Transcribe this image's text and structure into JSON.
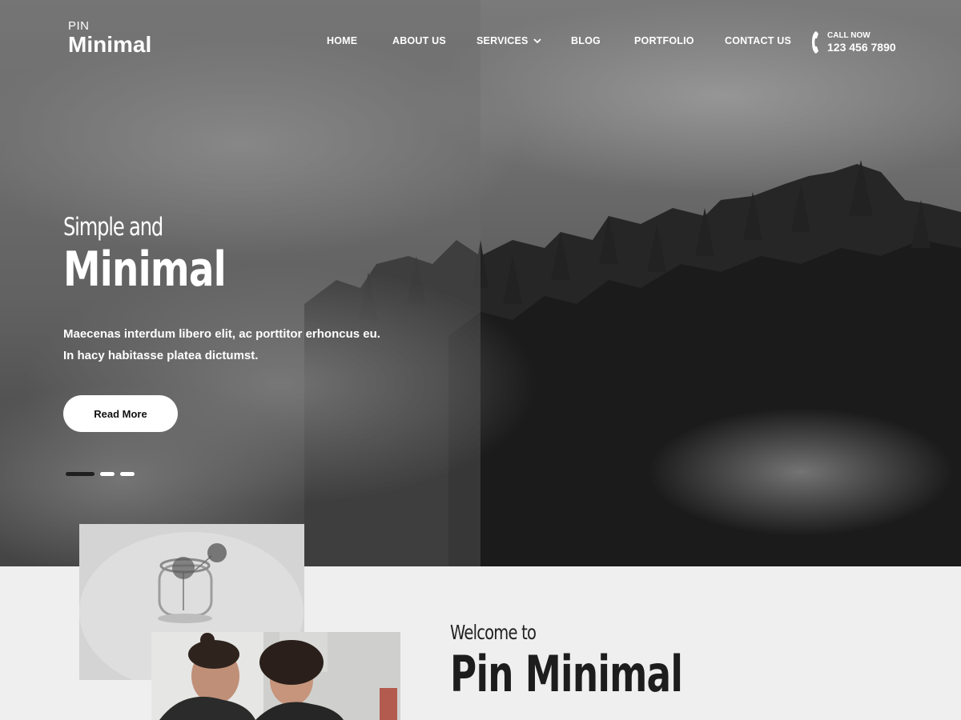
{
  "header": {
    "logo_pre": "PIN",
    "logo_main": "Minimal",
    "nav": [
      {
        "label": "HOME"
      },
      {
        "label": "ABOUT US"
      },
      {
        "label": "SERVICES"
      },
      {
        "label": "BLOG"
      },
      {
        "label": "PORTFOLIO"
      },
      {
        "label": "CONTACT US"
      }
    ],
    "call_label": "CALL NOW",
    "call_number": "123 456 7890"
  },
  "hero": {
    "subtitle": "Simple and",
    "title": "Minimal",
    "description": "Maecenas interdum libero elit, ac porttitor erhoncus eu. In hacy habitasse platea dictumst.",
    "button_label": "Read More",
    "slides_total": 3,
    "active_slide": 1
  },
  "welcome": {
    "subtitle": "Welcome to",
    "title": "Pin Minimal"
  },
  "colors": {
    "text_light": "#ffffff",
    "text_dark": "#1d1d1d",
    "section_bg": "#efefef",
    "active_dot": "#1f1f1f"
  }
}
